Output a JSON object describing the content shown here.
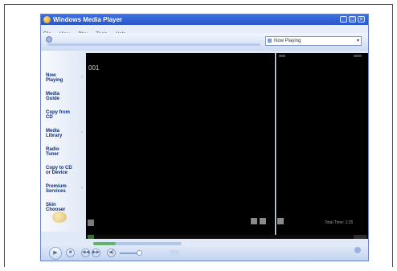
{
  "window": {
    "title": "Windows Media Player",
    "controls": {
      "minimize": "_",
      "maximize": "□",
      "close": "×"
    }
  },
  "menu": {
    "items": [
      "File",
      "View",
      "Play",
      "Tools",
      "Help"
    ]
  },
  "now_playing_select": {
    "value": "Now Playing",
    "arrow": "▾"
  },
  "taskbar": {
    "items": [
      {
        "label": "Now\nPlaying"
      },
      {
        "label": "Media\nGuide"
      },
      {
        "label": "Copy from\nCD"
      },
      {
        "label": "Media\nLibrary"
      },
      {
        "label": "Radio\nTuner"
      },
      {
        "label": "Copy to CD\nor Device"
      },
      {
        "label": "Premium\nServices"
      },
      {
        "label": "Skin\nChooser"
      }
    ],
    "chevron": "›"
  },
  "video": {
    "label": "001"
  },
  "playlist": {
    "total_time": "Total Time: 1:25"
  },
  "seek": {
    "progress": 0.25
  },
  "transport": {
    "play": "▶",
    "stop": "■",
    "prev": "◀◀",
    "next": "▶▶",
    "mute": "◀)"
  },
  "colors": {
    "accent": "#2a56c8",
    "window_bg": "#dfe9f7",
    "video_bg": "#000000",
    "seek_fill": "#5fb36a"
  },
  "icons": {
    "app_logo": "windows-media-player-logo-icon",
    "now_playing": "now-playing-icon",
    "eq": "equalizer-icon"
  }
}
